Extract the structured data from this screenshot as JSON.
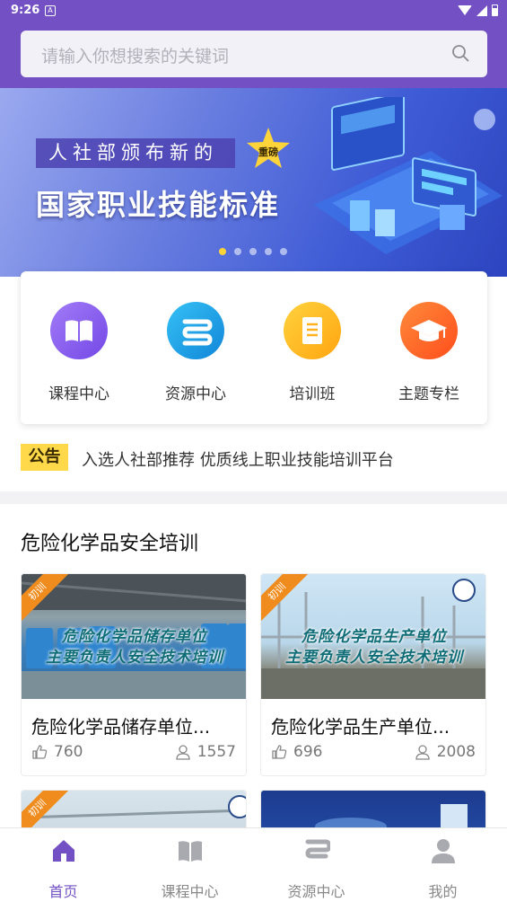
{
  "status_bar": {
    "time": "9:26",
    "notification_icon": "A"
  },
  "search": {
    "placeholder": "请输入你想搜索的关键词"
  },
  "banner": {
    "subtitle": "人社部颁布新的",
    "title": "国家职业技能标准",
    "badge": "重磅",
    "dot_count": 5,
    "active_dot": 0
  },
  "menu": [
    {
      "label": "课程中心",
      "icon": "book-icon",
      "color": "#8a5cf0"
    },
    {
      "label": "资源中心",
      "icon": "resource-icon",
      "color": "#1ba5e8"
    },
    {
      "label": "培训班",
      "icon": "document-icon",
      "color": "#ffb81c"
    },
    {
      "label": "主题专栏",
      "icon": "graduation-cap-icon",
      "color": "#ff6a24"
    }
  ],
  "notice": {
    "tag": "公告",
    "text": "入选人社部推荐 优质线上职业技能培训平台"
  },
  "section": {
    "title": "危险化学品安全培训"
  },
  "courses": [
    {
      "title": "危险化学品储存单位...",
      "caption_line1": "危险化学品储存单位",
      "caption_line2": "主要负责人安全技术培训",
      "tag": "初训",
      "likes": "760",
      "views": "1557"
    },
    {
      "title": "危险化学品生产单位...",
      "caption_line1": "危险化学品生产单位",
      "caption_line2": "主要负责人安全技术培训",
      "tag": "初训",
      "likes": "696",
      "views": "2008"
    },
    {
      "title": "",
      "tag": "初训",
      "likes": "",
      "views": ""
    },
    {
      "title": "",
      "tag": "",
      "likes": "",
      "views": ""
    }
  ],
  "bottom_nav": [
    {
      "label": "首页",
      "icon": "home-icon",
      "active": true
    },
    {
      "label": "课程中心",
      "icon": "book-icon",
      "active": false
    },
    {
      "label": "资源中心",
      "icon": "resource-icon",
      "active": false
    },
    {
      "label": "我的",
      "icon": "user-icon",
      "active": false
    }
  ],
  "colors": {
    "brand": "#7350c4",
    "notice": "#ffd94a",
    "ribbon": "#f08c1e"
  }
}
